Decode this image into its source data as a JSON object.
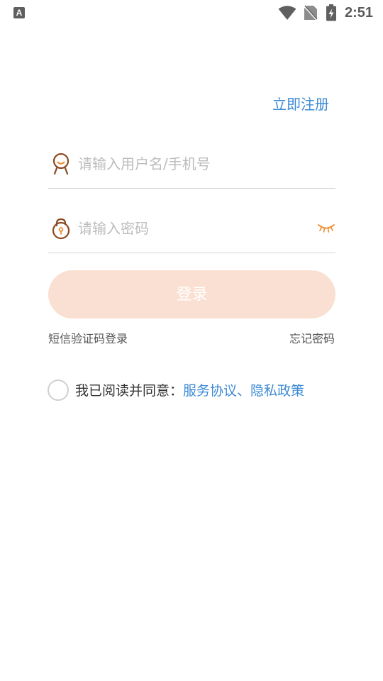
{
  "status_bar": {
    "app_icon_letter": "A",
    "time": "2:51",
    "icons": [
      "app-notification-icon",
      "wifi-icon",
      "no-sim-icon",
      "battery-charging-icon"
    ]
  },
  "header": {
    "register_label": "立即注册"
  },
  "username": {
    "icon": "user-icon",
    "placeholder": "请输入用户名/手机号",
    "value": ""
  },
  "password": {
    "icon": "lock-icon",
    "placeholder": "请输入密码",
    "value": "",
    "toggle_icon": "eye-closed-icon"
  },
  "login": {
    "button_label": "登录"
  },
  "links": {
    "sms_login": "短信验证码登录",
    "forgot_password": "忘记密码"
  },
  "agreement": {
    "checked": false,
    "prefix": "我已阅读并同意：",
    "service_agreement": "服务协议",
    "separator": "、",
    "privacy_policy": "隐私政策"
  },
  "colors": {
    "accent_blue": "#3d8bd5",
    "icon_brown": "#8a4a22",
    "eye_orange": "#f08a2c",
    "login_button_bg": "#fae0d2",
    "divider": "#d6d6d6"
  }
}
